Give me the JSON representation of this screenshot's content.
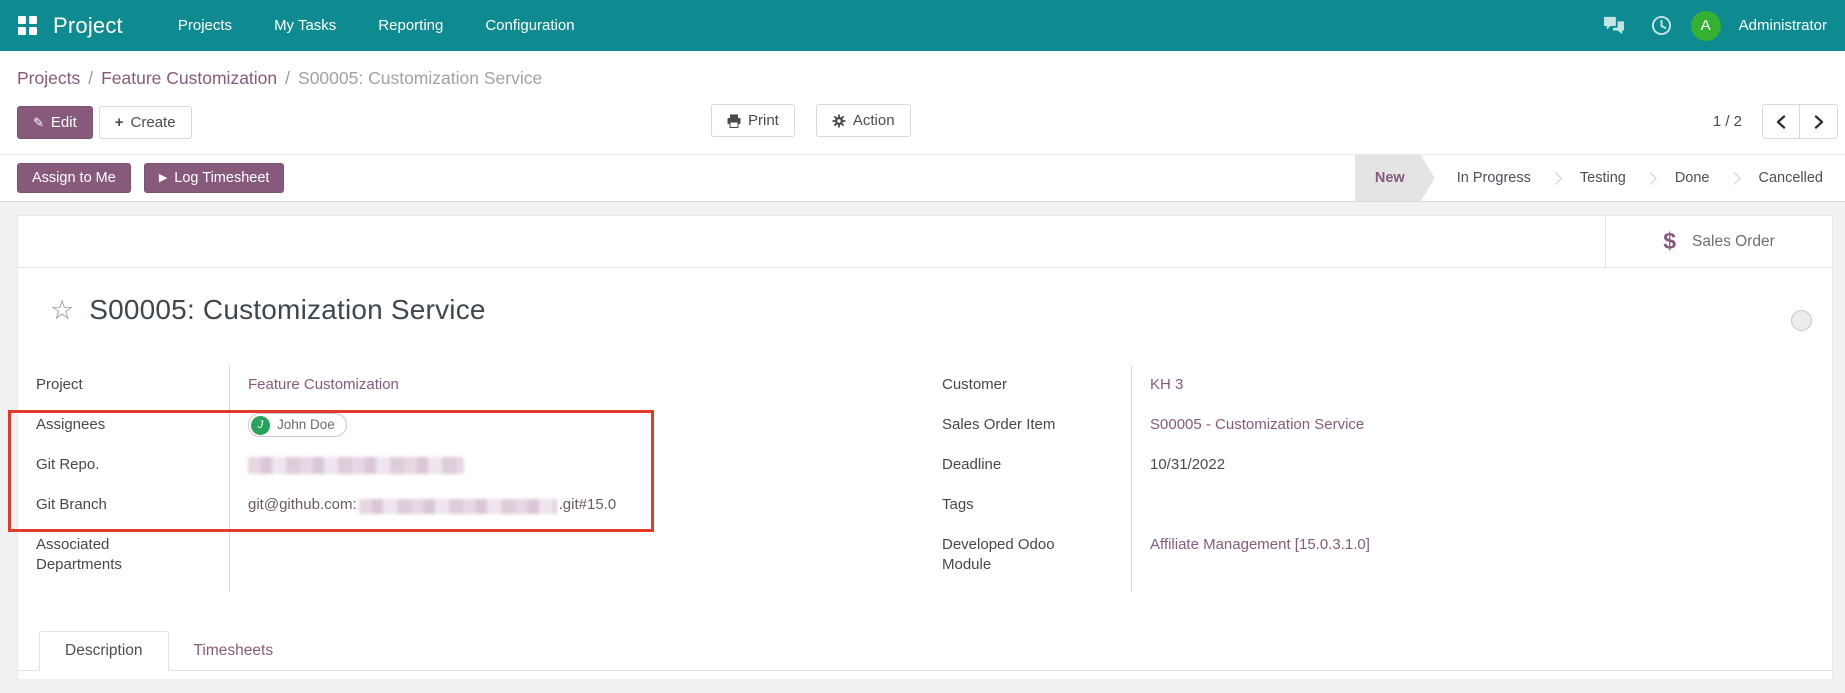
{
  "navbar": {
    "brand": "Project",
    "menus": [
      {
        "label": "Projects"
      },
      {
        "label": "My Tasks"
      },
      {
        "label": "Reporting"
      },
      {
        "label": "Configuration"
      }
    ],
    "user": {
      "name": "Administrator",
      "avatar_initial": "A"
    },
    "icons": {
      "apps": "apps-grid-icon",
      "messages": "chat-bubbles-icon",
      "activities": "clock-icon"
    }
  },
  "breadcrumb": {
    "links": [
      {
        "label": "Projects"
      },
      {
        "label": "Feature Customization"
      }
    ],
    "separator": "/",
    "current": "S00005: Customization Service"
  },
  "control_panel": {
    "edit_label": "Edit",
    "create_label": "Create",
    "print_label": "Print",
    "action_label": "Action",
    "pager": {
      "text": "1 / 2"
    }
  },
  "status_bar": {
    "assign_to_me_label": "Assign to Me",
    "log_timesheet_label": "Log Timesheet",
    "stages": [
      {
        "label": "New",
        "active": true
      },
      {
        "label": "In Progress",
        "active": false
      },
      {
        "label": "Testing",
        "active": false
      },
      {
        "label": "Done",
        "active": false
      },
      {
        "label": "Cancelled",
        "active": false
      }
    ]
  },
  "smart_buttons": [
    {
      "label": "Sales Order",
      "icon": "dollar-icon",
      "symbol": "$"
    }
  ],
  "task": {
    "title": "S00005: Customization Service",
    "fields_left": [
      {
        "label": "Project",
        "value": "Feature Customization",
        "type": "link"
      },
      {
        "label": "Assignees",
        "value": "John Doe",
        "avatar_initial": "J",
        "type": "avatar-tag"
      },
      {
        "label": "Git Repo.",
        "value": "",
        "type": "redacted"
      },
      {
        "label": "Git Branch",
        "value_prefix": "git@github.com:",
        "value_suffix": ".git#15.0",
        "type": "partially-redacted"
      },
      {
        "label": "Associated Departments",
        "value": "",
        "type": "empty"
      }
    ],
    "fields_right": [
      {
        "label": "Customer",
        "value": "KH 3",
        "type": "link"
      },
      {
        "label": "Sales Order Item",
        "value": "S00005 - Customization Service",
        "type": "link"
      },
      {
        "label": "Deadline",
        "value": "10/31/2022",
        "type": "text"
      },
      {
        "label": "Tags",
        "value": "",
        "type": "empty"
      },
      {
        "label": "Developed Odoo Module",
        "value": "Affiliate Management [15.0.3.1.0]",
        "type": "link"
      }
    ]
  },
  "tabs": [
    {
      "label": "Description",
      "active": true
    },
    {
      "label": "Timesheets",
      "active": false
    }
  ],
  "annotation": {
    "type": "highlight-box",
    "color": "#e23a2b"
  },
  "colors": {
    "navbar_bg": "#0e8b91",
    "primary_purple": "#875A7B",
    "link_purple": "#875A7B",
    "text_dark": "#43494e",
    "muted_gray": "#9a9a9a",
    "avatar_green_user": "#36b030",
    "avatar_green_assignee": "#27a35b",
    "highlight_red": "#e23a2b",
    "stage_active_bg": "#e4e4e4"
  }
}
